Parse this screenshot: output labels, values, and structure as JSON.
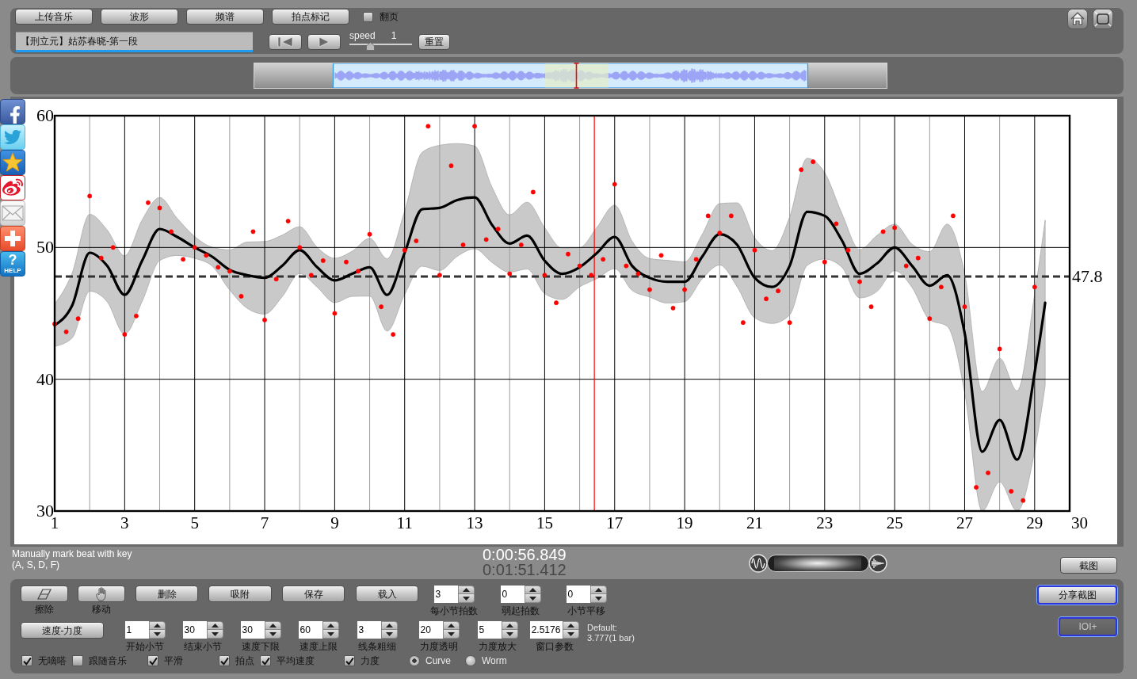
{
  "toolbar": {
    "buttons": [
      {
        "label": "上传音乐"
      },
      {
        "label": "波形"
      },
      {
        "label": "频谱"
      },
      {
        "label": "拍点标记"
      }
    ],
    "page_turn": {
      "label": "翻页",
      "checked": false
    }
  },
  "track": {
    "title": "【刑立元】姑苏春晓-第一段"
  },
  "transport": {
    "speed_label": "speed",
    "speed_value": "1",
    "speed_slider": {
      "level": 0.34
    },
    "reset_label": "重置"
  },
  "overview": {
    "playhead": {
      "level": 0.51
    }
  },
  "share_bar": [
    {
      "kind": "facebook"
    },
    {
      "kind": "twitter"
    },
    {
      "kind": "qzone"
    },
    {
      "kind": "weibo"
    },
    {
      "kind": "mail"
    },
    {
      "kind": "add"
    },
    {
      "kind": "help",
      "glyph": "?",
      "label": "HELP"
    }
  ],
  "chart": {
    "chart_data": {
      "type": "scatter",
      "grid": true,
      "xlim": [
        1,
        30
      ],
      "ylim": [
        30,
        60
      ],
      "xticks": [
        1,
        3,
        5,
        7,
        9,
        11,
        13,
        15,
        17,
        19,
        21,
        23,
        25,
        27,
        29,
        30
      ],
      "yticks": [
        30,
        40,
        50,
        60
      ],
      "series": [
        {
          "color": "#ff0000",
          "x": [
            1,
            1.33,
            1.67,
            2,
            2.33,
            2.67,
            3,
            3.33,
            3.67,
            4,
            4.33,
            4.67,
            5,
            5.33,
            5.67,
            6,
            6.33,
            6.67,
            7,
            7.33,
            7.67,
            8,
            8.33,
            8.67,
            9,
            9.33,
            9.67,
            10,
            10.33,
            10.67,
            11,
            11.33,
            11.67,
            12,
            12.33,
            12.67,
            13,
            13.33,
            13.67,
            14,
            14.33,
            14.67,
            15,
            15.33,
            15.67,
            16,
            16.33,
            16.67,
            17,
            17.33,
            17.67,
            18,
            18.33,
            18.67,
            19,
            19.33,
            19.67,
            20,
            20.33,
            20.67,
            21,
            21.33,
            21.67,
            22,
            22.33,
            22.67,
            23,
            23.33,
            23.67,
            24,
            24.33,
            24.67,
            25,
            25.33,
            25.67,
            26,
            26.33,
            26.67,
            27,
            27.33,
            27.67,
            28,
            28.33,
            28.67,
            29
          ],
          "values": [
            44.2,
            43.6,
            44.6,
            53.9,
            49.2,
            50,
            43.4,
            44.8,
            53.4,
            53.0,
            51.2,
            49.1,
            50,
            49.4,
            48.5,
            48.2,
            46.3,
            51.2,
            44.5,
            47.6,
            52,
            50,
            47.9,
            49.0,
            45,
            48.9,
            48.2,
            51,
            45.5,
            43.4,
            49.8,
            50.5,
            59.2,
            47.9,
            56.2,
            50.2,
            59.2,
            50.6,
            51.4,
            48,
            50.2,
            54.2,
            47.9,
            45.8,
            49.5,
            48.6,
            47.9,
            49.1,
            54.8,
            48.6,
            48.0,
            46.8,
            49.4,
            45.4,
            46.8,
            49.1,
            52.4,
            51.1,
            52.4,
            44.3,
            49.8,
            46.1,
            46.7,
            44.3,
            55.9,
            56.5,
            48.9,
            51.8,
            49.8,
            47.4,
            45.5,
            51.2,
            51.5,
            48.6,
            49.2,
            44.6,
            47.0,
            52.4,
            45.5,
            31.8,
            32.9,
            42.3,
            31.5,
            30.8,
            47.0
          ]
        },
        {
          "type": "line",
          "color": "#000000",
          "x": [
            1,
            1.5,
            2,
            2.5,
            3,
            3.5,
            4,
            4.5,
            5,
            5.5,
            6,
            6.5,
            7,
            7.5,
            8,
            8.5,
            9,
            9.5,
            10,
            10.5,
            11,
            11.5,
            12,
            12.5,
            13,
            13.5,
            14,
            14.5,
            15,
            15.5,
            16,
            16.5,
            17,
            17.5,
            18,
            18.5,
            19,
            19.5,
            20,
            20.5,
            21,
            21.5,
            22,
            22.5,
            23,
            23.5,
            24,
            24.5,
            25,
            25.5,
            26,
            26.5,
            27,
            27.5,
            28,
            28.5,
            29,
            29.3
          ],
          "values": [
            44.1,
            45.6,
            49.6,
            48.6,
            46.4,
            49.0,
            51.4,
            50.8,
            50.0,
            49.3,
            48.3,
            47.9,
            47.7,
            48.6,
            49.8,
            48.5,
            47.5,
            48.0,
            48.5,
            46.4,
            49.6,
            52.9,
            53.0,
            53.6,
            53.8,
            51.7,
            50.3,
            50.9,
            49.0,
            48.0,
            48.5,
            49.6,
            50.8,
            48.6,
            47.7,
            47.4,
            47.4,
            49.3,
            51.0,
            50.2,
            47.7,
            47.0,
            48.6,
            52.7,
            52.4,
            50.5,
            48.0,
            48.8,
            50.0,
            48.6,
            47.1,
            47.9,
            43.5,
            34.5,
            36.9,
            33.9,
            40.5,
            45.8
          ]
        }
      ],
      "ref_lines": [
        {
          "axis": "y",
          "value": 47.8,
          "label": "47.8"
        },
        {
          "axis": "x",
          "value": 16.42,
          "color": "#ff0000"
        }
      ]
    }
  },
  "status": {
    "hint": [
      "Manually mark beat with key",
      "(A, S, D, F)"
    ],
    "current_time": "0:00:56.849",
    "total_time": "0:01:51.412",
    "mix_slider": {
      "level": 0.5
    },
    "screenshot_label": "截图"
  },
  "editor": {
    "tools": [
      {
        "caption": "擦除"
      },
      {
        "caption": "移动"
      }
    ],
    "actions": [
      {
        "label": "删除"
      },
      {
        "label": "吸附"
      },
      {
        "label": "保存"
      },
      {
        "label": "载入"
      }
    ],
    "beat_fields": [
      {
        "label": "每小节拍数",
        "value": "3"
      },
      {
        "label": "弱起拍数",
        "value": "0"
      },
      {
        "label": "小节平移",
        "value": "0"
      }
    ],
    "mode_button": "速度-力度",
    "range_fields": [
      {
        "label": "开始小节",
        "value": "1"
      },
      {
        "label": "结束小节",
        "value": "30"
      },
      {
        "label": "速度下限",
        "value": "30"
      },
      {
        "label": "速度上限",
        "value": "60"
      },
      {
        "label": "线条粗细",
        "value": "3"
      },
      {
        "label": "力度透明",
        "value": "20"
      },
      {
        "label": "力度放大",
        "value": "5"
      },
      {
        "label": "窗口参数",
        "value": "2.5176"
      }
    ],
    "default_note": [
      "Default:",
      "3.777(1 bar)"
    ],
    "options": [
      {
        "kind": "checkbox",
        "label": "无嘀嗒",
        "checked": true
      },
      {
        "kind": "checkbox",
        "label": "跟随音乐",
        "checked": false
      },
      {
        "kind": "checkbox",
        "label": "平滑",
        "checked": true
      },
      {
        "kind": "checkbox",
        "label": "拍点",
        "checked": true
      },
      {
        "kind": "checkbox",
        "label": "平均速度",
        "checked": true
      },
      {
        "kind": "checkbox",
        "label": "力度",
        "checked": true
      },
      {
        "kind": "radio",
        "label": "Curve",
        "selected": true
      },
      {
        "kind": "radio",
        "label": "Worm",
        "selected": false
      }
    ],
    "side_buttons": [
      {
        "label": "分享截图",
        "highlighted": true,
        "disabled": false
      },
      {
        "label": "IOI+",
        "highlighted": true,
        "disabled": true
      }
    ]
  }
}
